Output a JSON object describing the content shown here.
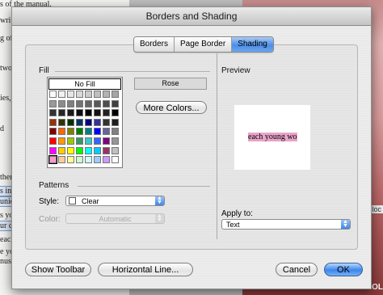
{
  "background_document": {
    "lines": [
      "",
      "s of the manual.",
      "writte",
      "g of “",
      "two c",
      "ies, o",
      "d",
      "then",
      "s in",
      "uniq",
      "s you",
      "ur c",
      "each",
      "e you",
      "nuse"
    ]
  },
  "background_photo": {
    "text_right_mid": "loc",
    "text_bottom": "HOL"
  },
  "dialog": {
    "title": "Borders and Shading",
    "tabs": [
      {
        "label": "Borders",
        "active": false
      },
      {
        "label": "Page Border",
        "active": false
      },
      {
        "label": "Shading",
        "active": true
      }
    ],
    "fill": {
      "section_label": "Fill",
      "no_fill_label": "No Fill",
      "selected_color_name": "Rose",
      "more_colors_label": "More Colors...",
      "swatch_rows": [
        [
          "#ffffff",
          "#f2f2f2",
          "#e6e6e6",
          "#d9d9d9",
          "#cccccc",
          "#bfbfbf",
          "#b3b3b3",
          "#a6a6a6"
        ],
        [
          "#999999",
          "#8c8c8c",
          "#808080",
          "#737373",
          "#666666",
          "#595959",
          "#4d4d4d",
          "#404040"
        ],
        [
          "#333333",
          "#262626",
          "#1a1a1a",
          "#0d0d0d",
          "#000000",
          "#111111",
          "#222222",
          "#000000"
        ],
        [
          "#993300",
          "#333300",
          "#003300",
          "#003366",
          "#000080",
          "#333399",
          "#333333",
          "#1f1f1f"
        ],
        [
          "#800000",
          "#ff6600",
          "#808000",
          "#008000",
          "#008080",
          "#0000ff",
          "#666699",
          "#808080"
        ],
        [
          "#ff0000",
          "#ff9900",
          "#99cc00",
          "#339966",
          "#33cccc",
          "#3366ff",
          "#800080",
          "#969696"
        ],
        [
          "#ff00ff",
          "#ffcc00",
          "#ffff00",
          "#00ff00",
          "#00ffff",
          "#00ccff",
          "#993366",
          "#c0c0c0"
        ],
        [
          "#ff99cc",
          "#ffcc99",
          "#ffff99",
          "#ccffcc",
          "#ccffff",
          "#99ccff",
          "#cc99ff",
          "#ffffff"
        ]
      ],
      "selected_swatch": [
        7,
        0
      ]
    },
    "patterns": {
      "section_label": "Patterns",
      "style_label": "Style:",
      "style_value": "Clear",
      "color_label": "Color:",
      "color_value": "Automatic"
    },
    "preview": {
      "section_label": "Preview",
      "sample_text": "each young wo",
      "highlight_color": "#e8a4c8"
    },
    "apply_to": {
      "label": "Apply to:",
      "value": "Text"
    },
    "buttons": {
      "show_toolbar": "Show Toolbar",
      "horizontal_line": "Horizontal Line...",
      "cancel": "Cancel",
      "ok": "OK"
    }
  },
  "colors": {
    "accent_blue": "#4c8ee8",
    "photo_rose": "#c88c8c"
  }
}
